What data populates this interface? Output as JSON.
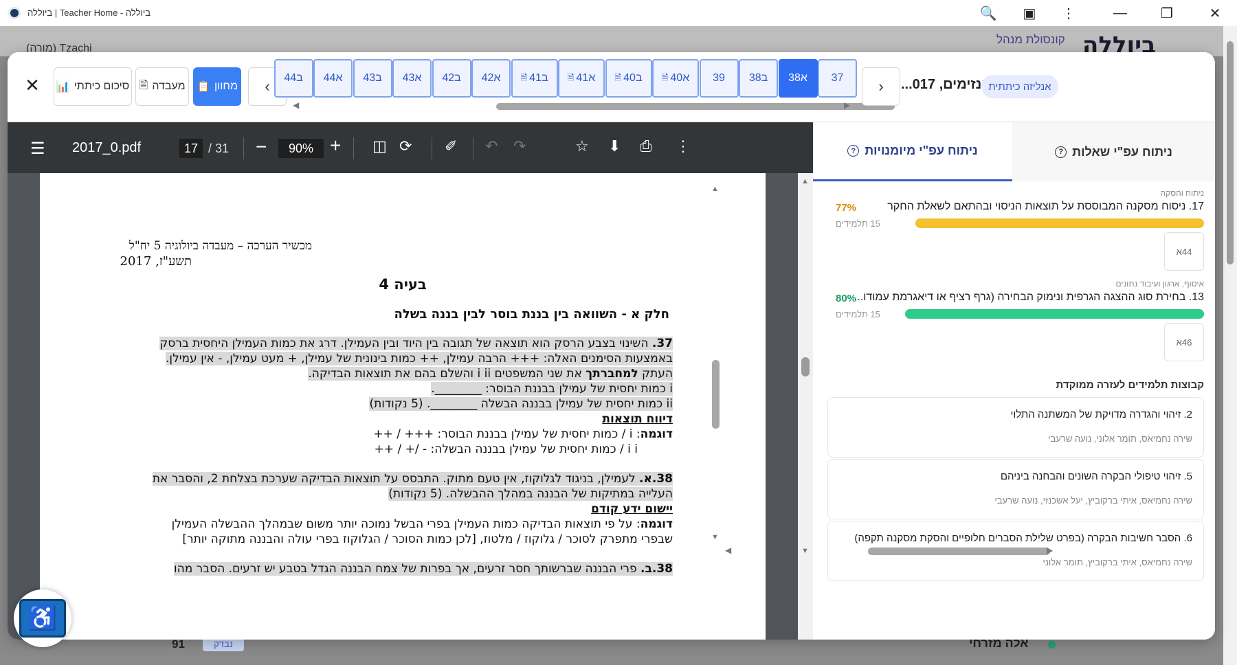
{
  "window": {
    "title": "ביוללה | Teacher Home - ביוללה",
    "zoom_icon": "magnifier-icon",
    "extension_icon": "puzzle-icon"
  },
  "background": {
    "brand": "ביוללה",
    "console_link": "קונסולת מנהל",
    "user_name": "(מורה) Tzachi",
    "bottom_name": "אלה מזרחי",
    "bottom_score": "91",
    "bottom_badge": "נבדק"
  },
  "header": {
    "title": "אנזימים, 017...",
    "ai_badge": "אנליזה כיתתית",
    "buttons": {
      "summary": "סיכום כיתתי",
      "lab": "מעבדה",
      "exam": "מחוון"
    },
    "questions": [
      {
        "label": "37",
        "doc": false,
        "active": false
      },
      {
        "label": "38א",
        "doc": false,
        "active": true
      },
      {
        "label": "38ב",
        "doc": false,
        "active": false
      },
      {
        "label": "39",
        "doc": false,
        "active": false
      },
      {
        "label": "40א",
        "doc": true,
        "active": false
      },
      {
        "label": "40ב",
        "doc": true,
        "active": false
      },
      {
        "label": "41א",
        "doc": true,
        "active": false
      },
      {
        "label": "41ב",
        "doc": true,
        "active": false
      },
      {
        "label": "42א",
        "doc": false,
        "active": false
      },
      {
        "label": "42ב",
        "doc": false,
        "active": false
      },
      {
        "label": "43א",
        "doc": false,
        "active": false
      },
      {
        "label": "43ב",
        "doc": false,
        "active": false
      },
      {
        "label": "44א",
        "doc": false,
        "active": false
      },
      {
        "label": "44ב",
        "doc": false,
        "active": false
      }
    ]
  },
  "pdf": {
    "file_name": "2017_0.pdf",
    "page_current": "17",
    "page_total": "/ 31",
    "zoom": "90%",
    "lines": {
      "head1": "מכשיר הערכה – מעבדה ביולוגיה 5 יח\"ל",
      "head2": "תשע\"ז, 2017",
      "title": "בעיה 4",
      "subtitle": "חלק א - השוואה בין בננת בוסר לבין בננה בשלה",
      "q37_num": "37.",
      "q37_l1": " השינוי בצבע הרסק הוא תוצאה של תגובה בין היוד ובין העמילן. דרג את כמות העמילן היחסית ברסק",
      "q37_l2": "באמצעות הסימנים האלה: +++ הרבה עמילן, ++ כמות בינונית של עמילן, + מעט עמילן, - אין עמילן.",
      "q37_l3_a": "העתק ",
      "q37_l3_b": "למחברתך",
      "q37_l3_c": " את שני המשפטים i ii והשלם בהם את תוצאות הבדיקה.",
      "q37_l4": "i כמות יחסית של עמילן בבננת הבוסר: ________.",
      "q37_l5": "ii כמות יחסית של עמילן בבננה הבשלה ________.   (5 נקודות)",
      "results_head": "דיווח תוצאות",
      "ex_label": "דוגמה",
      "ex1": ": i / כמות יחסית של עמילן בבננת הבוסר: +++ / ++",
      "ex2": "i i / כמות יחסית של עמילן בבננה הבשלה: - /+ / ++",
      "q38a_num": "38.א.",
      "q38a_l1": " לעמילן, בניגוד לגלוקוז, אין טעם מתוק. התבסס על תוצאות הבדיקה שערכת בצלחת 2, והסבר את",
      "q38a_l2": "העלייה במתיקות של הבננה במהלך ההבשלה. (5 נקודות)",
      "prior_head": "יישום ידע קודם",
      "ex3": ": על פי תוצאות הבדיקה כמות העמילן בפרי הבשל נמוכה יותר משום שבמהלך ההבשלה העמילן",
      "ex4": "שבפרי מתפרק לסוכר / גלוקוז / מלטוז, [לכן כמות הסוכר / הגלוקוז בפרי עולה והבננה מתוקה יותר]",
      "q38b_num": "38.ב.",
      "q38b_l1": " פרי הבננה שברשותך חסר זרעים, אך בפרות של צמח הבננה הגדל בטבע יש זרעים. הסבר מהו"
    }
  },
  "tabs": {
    "by_question": "ניתוח עפ\"י שאלות",
    "by_skill": "ניתוח עפ\"י מיומנויות"
  },
  "analysis": {
    "items": [
      {
        "category": "ניתוח והסקה",
        "title": "17. ניסוח מסקנה המבוססת על תוצאות הניסוי ובהתאם לשאלת החקר",
        "percent": "77%",
        "value": 77,
        "students": "15 תלמידים",
        "color": "#f5c12e",
        "pct_color": "#e08a00",
        "tag": "44א"
      },
      {
        "category": "איסוף, ארגון ועיבוד נתונים",
        "title": "13. בחירת סוג ההצגה הגרפית ונימוק הבחירה (גרף רציף או דיאגרמת עמודו...",
        "percent": "80%",
        "value": 80,
        "students": "15 תלמידים",
        "color": "#2ecc8a",
        "pct_color": "#1a9d63",
        "tag": "46א"
      }
    ],
    "groups_head": "קבוצות תלמידים לעזרה ממוקדת",
    "groups": [
      {
        "title": "2. זיהוי והגדרה מדויקת של המשתנה התלוי",
        "names": "שירה נחמיאס, תומר אלוני, נועה שרעבי"
      },
      {
        "title": "5. זיהוי טיפולי הבקרה השונים והבחנה ביניהם",
        "names": "שירה נחמיאס, איתי ברקוביץ, יעל אשכנזי, נועה שרעבי"
      },
      {
        "title": "6. הסבר חשיבות הבקרה (בפרט שלילת הסברים חלופיים והסקת מסקנה תקפה)",
        "names": "שירה נחמיאס, איתי ברקוביץ, תומר אלוני"
      }
    ]
  },
  "accessibility": {
    "icon": "accessibility-icon"
  }
}
